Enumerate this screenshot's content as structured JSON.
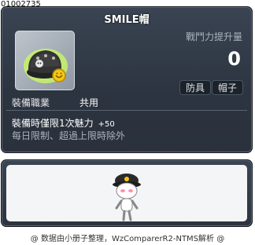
{
  "item_id": "01002735",
  "item": {
    "name": "SMILE帽",
    "icon": "smile-hat-icon"
  },
  "stat": {
    "label": "戰鬥力提升量",
    "value": "0"
  },
  "tags": {
    "type": "防具",
    "subtype": "帽子"
  },
  "job": {
    "label": "裝備職業",
    "value": "共用"
  },
  "effect": {
    "text": "裝備時僅限1次魅力",
    "bonus": "+50"
  },
  "limit_text": "每日限制、超過上限時除外",
  "character_preview": "character-icon",
  "footer": "@ 数据由小册子整理，WzComparerR2-NTMS解析 @",
  "colors": {
    "panel": "#2c3440",
    "label": "#aab3bd",
    "text": "#ffffff"
  }
}
